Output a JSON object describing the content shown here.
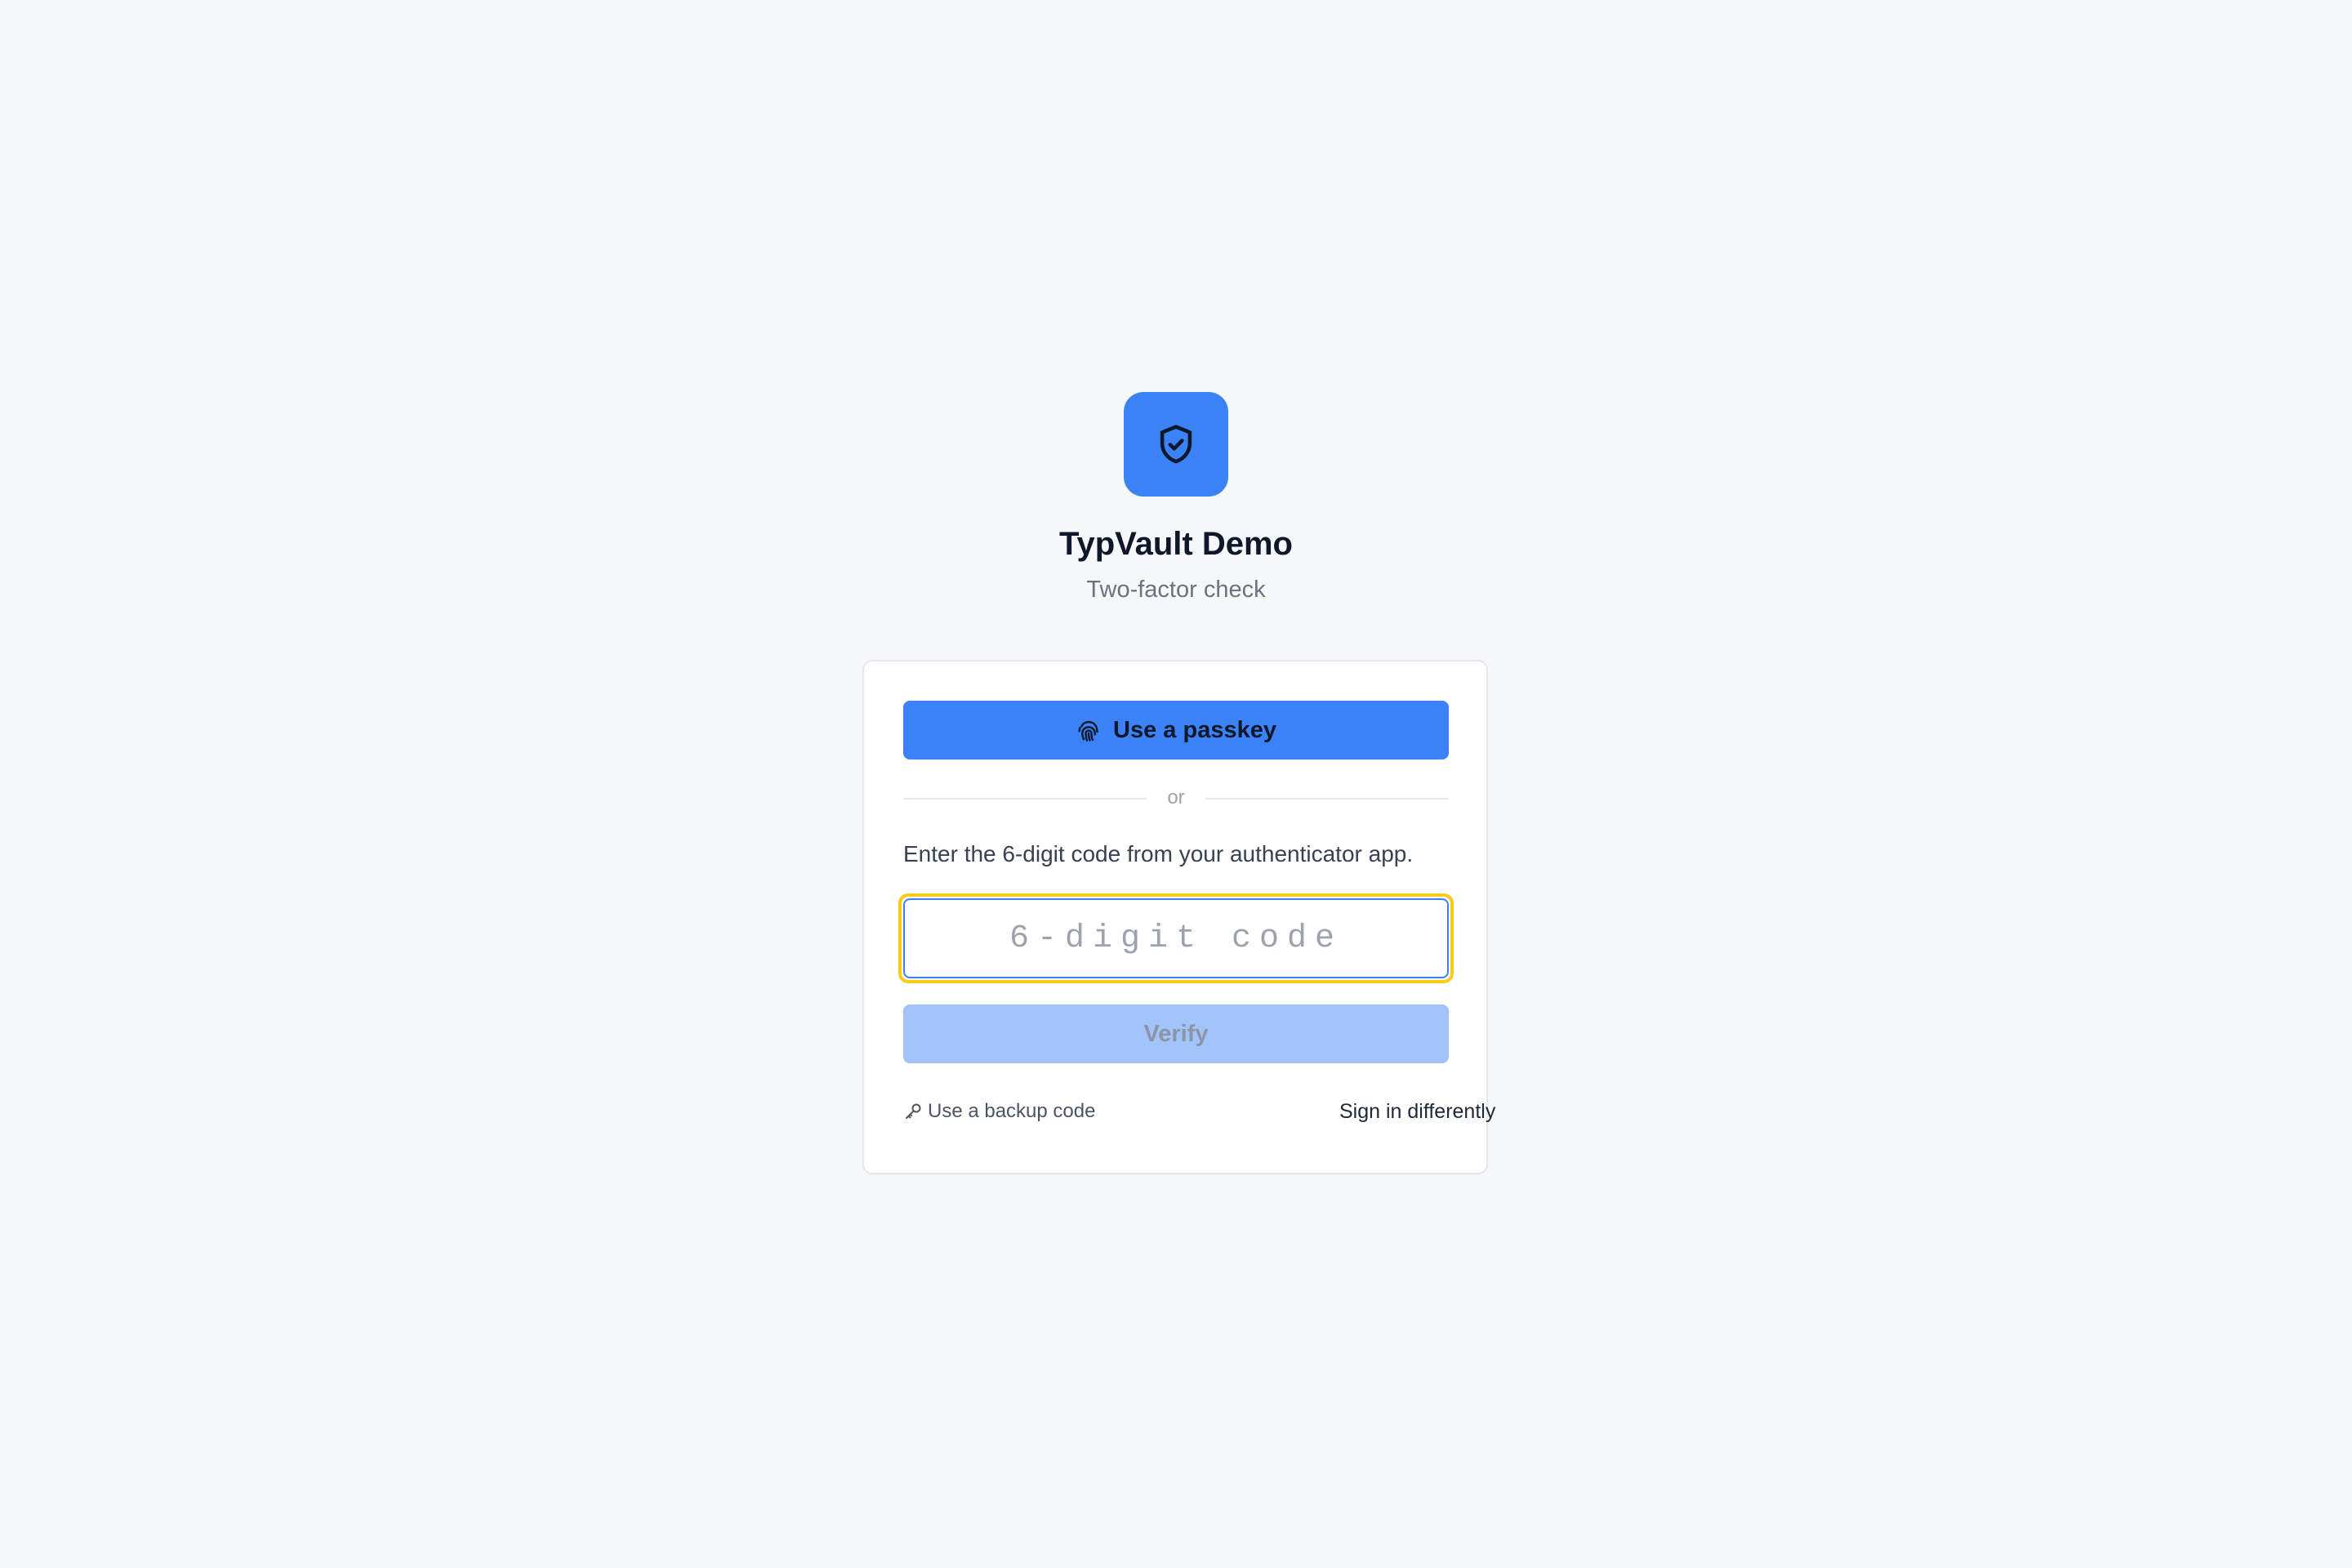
{
  "brand": {
    "app_name": "TypVault Demo",
    "subtitle": "Two-factor check",
    "logo_icon": "shield-check-icon",
    "accent_color": "#3b82f6"
  },
  "auth_card": {
    "passkey_button": {
      "label": "Use a passkey",
      "icon": "fingerprint-icon"
    },
    "divider_text": "or",
    "instructions": "Enter the 6-digit code from your authenticator app.",
    "code_input": {
      "placeholder": "6-digit code",
      "value": "",
      "focus_ring_color": "#facc15"
    },
    "verify_button": {
      "label": "Verify",
      "state": "disabled"
    },
    "backup_link": {
      "label": "Use a backup code",
      "icon": "key-icon"
    },
    "alt_signin_link": {
      "label": "Sign in differently"
    }
  }
}
